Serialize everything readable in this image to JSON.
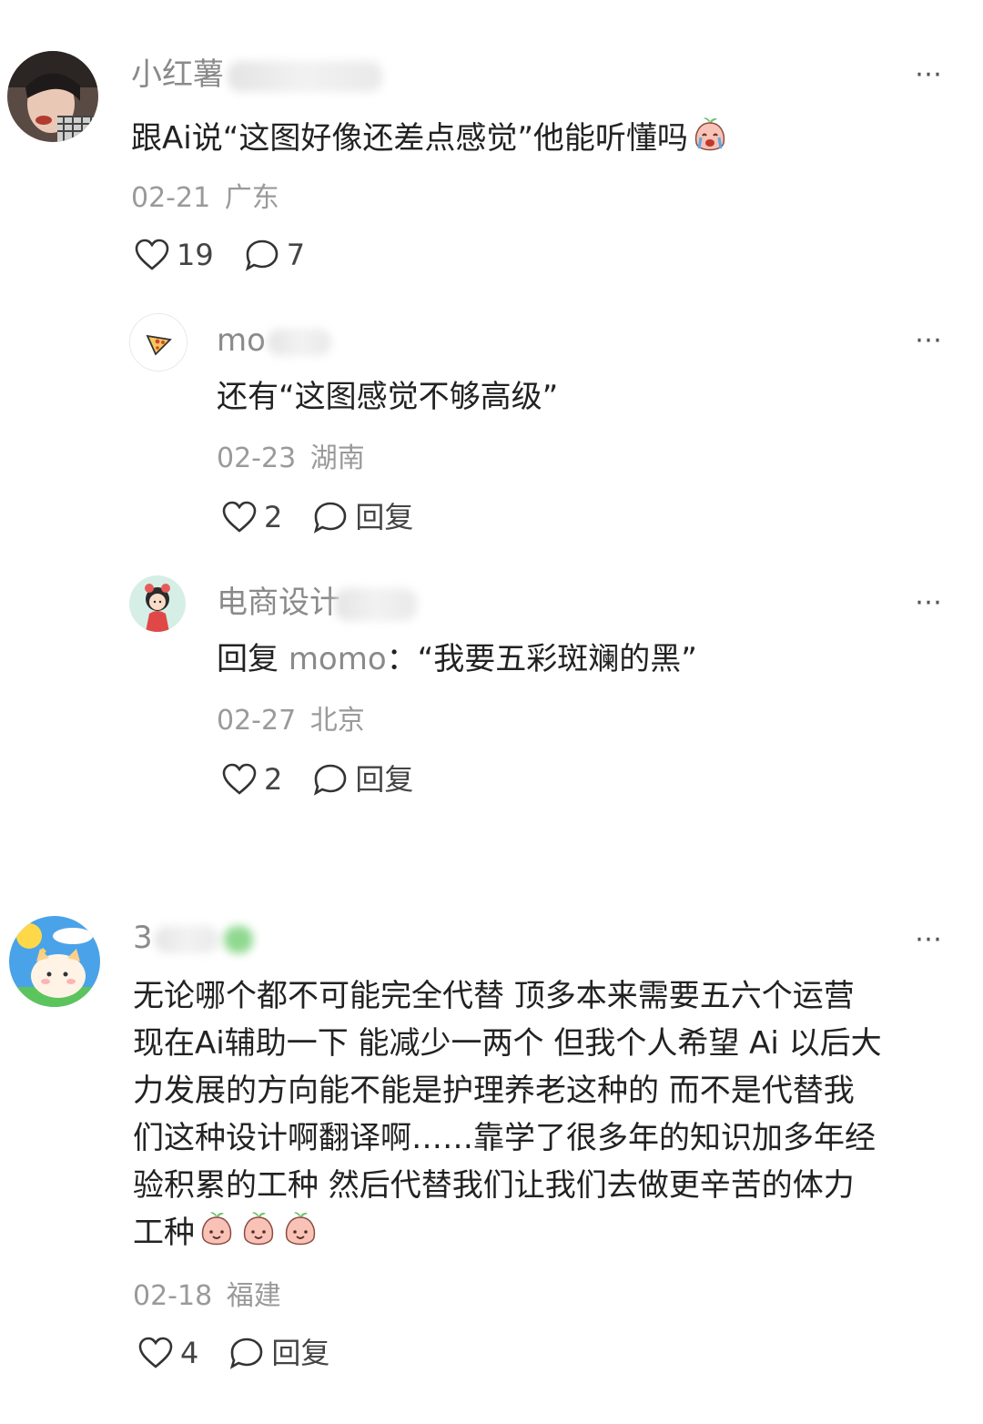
{
  "comments": [
    {
      "username": "小红薯",
      "text": "跟Ai说“这图好像还差点感觉”他能听懂吗",
      "emoji": "crying-peach-emoji",
      "date": "02-21",
      "location": "广东",
      "likes": "19",
      "replies": "7"
    },
    {
      "username": "mo",
      "text": "还有“这图感觉不够高级”",
      "date": "02-23",
      "location": "湖南",
      "likes": "2",
      "reply_label": "回复"
    },
    {
      "username": "电商设计",
      "reply_prefix": "回复",
      "reply_to": "momo",
      "text": "：“我要五彩斑斓的黑”",
      "date": "02-27",
      "location": "北京",
      "likes": "2",
      "reply_label": "回复"
    },
    {
      "username": "3",
      "text_lines": [
        "无论哪个都不可能完全代替 顶多本来需要五六个运营",
        "现在Ai辅助一下 能减少一两个 但我个人希望 Ai 以后大",
        "力发展的方向能不能是护理养老这种的 而不是代替我",
        "们这种设计啊翻译啊……靠学了很多年的知识加多年经",
        "验积累的工种 然后代替我们让我们去做更辛苦的体力",
        "工种"
      ],
      "emoji": "smiling-peach-emoji",
      "date": "02-18",
      "location": "福建",
      "likes": "4",
      "reply_label": "回复"
    }
  ],
  "more_icon": "⋯",
  "colors": {
    "muted": "#9a9a9a",
    "text": "#222222",
    "accent_green": "#8fd88f"
  }
}
